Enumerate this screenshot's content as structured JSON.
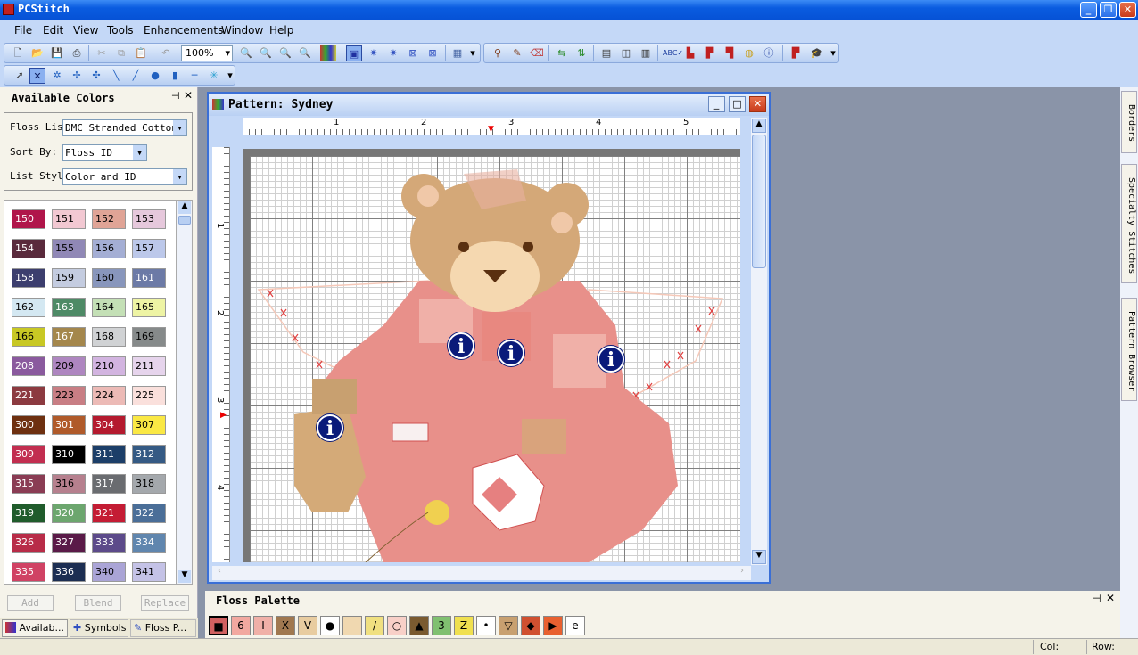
{
  "app": {
    "title": "PCStitch"
  },
  "menu": [
    "File",
    "Edit",
    "View",
    "Tools",
    "Enhancements",
    "Window",
    "Help"
  ],
  "toolbar": {
    "zoom": "100%"
  },
  "available_colors": {
    "title": "Available Colors",
    "floss_list_label": "Floss List:",
    "floss_list_value": "DMC Stranded Cotton",
    "sort_by_label": "Sort By:",
    "sort_by_value": "Floss ID",
    "list_style_label": "List Style:",
    "list_style_value": "Color and ID",
    "swatches": [
      {
        "id": "150",
        "color": "#b0154a",
        "text": "#fff"
      },
      {
        "id": "151",
        "color": "#f2c8d2",
        "text": "#000"
      },
      {
        "id": "152",
        "color": "#e0a496",
        "text": "#000"
      },
      {
        "id": "153",
        "color": "#e6c8dc",
        "text": "#000"
      },
      {
        "id": "154",
        "color": "#5a2a3c",
        "text": "#fff"
      },
      {
        "id": "155",
        "color": "#9088b6",
        "text": "#000"
      },
      {
        "id": "156",
        "color": "#a4aed4",
        "text": "#000"
      },
      {
        "id": "157",
        "color": "#bcc8ea",
        "text": "#000"
      },
      {
        "id": "158",
        "color": "#3c3e6e",
        "text": "#fff"
      },
      {
        "id": "159",
        "color": "#c4cce0",
        "text": "#000"
      },
      {
        "id": "160",
        "color": "#8896bc",
        "text": "#000"
      },
      {
        "id": "161",
        "color": "#6c7aa6",
        "text": "#fff"
      },
      {
        "id": "162",
        "color": "#d4e8f2",
        "text": "#000"
      },
      {
        "id": "163",
        "color": "#4e8a66",
        "text": "#fff"
      },
      {
        "id": "164",
        "color": "#c4e0b6",
        "text": "#000"
      },
      {
        "id": "165",
        "color": "#eef4a4",
        "text": "#000"
      },
      {
        "id": "166",
        "color": "#c8c824",
        "text": "#000"
      },
      {
        "id": "167",
        "color": "#a4874c",
        "text": "#fff"
      },
      {
        "id": "168",
        "color": "#d0d2d4",
        "text": "#000"
      },
      {
        "id": "169",
        "color": "#868a8a",
        "text": "#000"
      },
      {
        "id": "208",
        "color": "#8a5a9e",
        "text": "#fff"
      },
      {
        "id": "209",
        "color": "#ae86c0",
        "text": "#000"
      },
      {
        "id": "210",
        "color": "#d2b4e0",
        "text": "#000"
      },
      {
        "id": "211",
        "color": "#e6d4ec",
        "text": "#000"
      },
      {
        "id": "221",
        "color": "#8c3a40",
        "text": "#fff"
      },
      {
        "id": "223",
        "color": "#c87e84",
        "text": "#000"
      },
      {
        "id": "224",
        "color": "#ecbab6",
        "text": "#000"
      },
      {
        "id": "225",
        "color": "#fae0dc",
        "text": "#000"
      },
      {
        "id": "300",
        "color": "#6e3010",
        "text": "#fff"
      },
      {
        "id": "301",
        "color": "#b05a2a",
        "text": "#fff"
      },
      {
        "id": "304",
        "color": "#b41a2e",
        "text": "#fff"
      },
      {
        "id": "307",
        "color": "#fae844",
        "text": "#000"
      },
      {
        "id": "309",
        "color": "#c22e50",
        "text": "#fff"
      },
      {
        "id": "310",
        "color": "#000000",
        "text": "#fff"
      },
      {
        "id": "311",
        "color": "#1c3e68",
        "text": "#fff"
      },
      {
        "id": "312",
        "color": "#355a84",
        "text": "#fff"
      },
      {
        "id": "315",
        "color": "#8a3c54",
        "text": "#fff"
      },
      {
        "id": "316",
        "color": "#b6808e",
        "text": "#000"
      },
      {
        "id": "317",
        "color": "#6a6c70",
        "text": "#fff"
      },
      {
        "id": "318",
        "color": "#a4a8ac",
        "text": "#000"
      },
      {
        "id": "319",
        "color": "#205c2c",
        "text": "#fff"
      },
      {
        "id": "320",
        "color": "#6ca66e",
        "text": "#fff"
      },
      {
        "id": "321",
        "color": "#c41c34",
        "text": "#fff"
      },
      {
        "id": "322",
        "color": "#4a6e98",
        "text": "#fff"
      },
      {
        "id": "326",
        "color": "#b82c48",
        "text": "#fff"
      },
      {
        "id": "327",
        "color": "#5a1a48",
        "text": "#fff"
      },
      {
        "id": "333",
        "color": "#5c4a8a",
        "text": "#fff"
      },
      {
        "id": "334",
        "color": "#6086ae",
        "text": "#fff"
      },
      {
        "id": "335",
        "color": "#d04264",
        "text": "#fff"
      },
      {
        "id": "336",
        "color": "#1c2e52",
        "text": "#fff"
      },
      {
        "id": "340",
        "color": "#aaa4d6",
        "text": "#000"
      },
      {
        "id": "341",
        "color": "#c4c2e6",
        "text": "#000"
      }
    ],
    "add_label": "Add",
    "blend_label": "Blend",
    "replace_label": "Replace"
  },
  "bottom_tabs": [
    {
      "label": "Availab..."
    },
    {
      "label": "Symbols"
    },
    {
      "label": "Floss P..."
    }
  ],
  "pattern": {
    "title": "Pattern: Sydney",
    "ruler_h": [
      "1",
      "2",
      "3",
      "4",
      "5"
    ],
    "ruler_v": [
      "1",
      "2",
      "3",
      "4"
    ]
  },
  "side_tabs": [
    "Borders",
    "Specialty Stitches",
    "Pattern Browser"
  ],
  "floss_palette": {
    "title": "Floss Palette",
    "swatches": [
      {
        "sym": "■",
        "color": "#d06060"
      },
      {
        "sym": "6",
        "color": "#f2a8a0"
      },
      {
        "sym": "I",
        "color": "#f0b0a8"
      },
      {
        "sym": "X",
        "color": "#a07850"
      },
      {
        "sym": "V",
        "color": "#e8cca0"
      },
      {
        "sym": "●",
        "color": "#ffffff"
      },
      {
        "sym": "—",
        "color": "#f0d8b0"
      },
      {
        "sym": "/",
        "color": "#f0e080"
      },
      {
        "sym": "○",
        "color": "#f8d0c8"
      },
      {
        "sym": "▲",
        "color": "#7a5a30"
      },
      {
        "sym": "3",
        "color": "#80c070"
      },
      {
        "sym": "Z",
        "color": "#f0e050"
      },
      {
        "sym": "•",
        "color": "#ffffff"
      },
      {
        "sym": "▽",
        "color": "#c8a070"
      },
      {
        "sym": "◆",
        "color": "#d05030"
      },
      {
        "sym": "▶",
        "color": "#e86030"
      },
      {
        "sym": "e",
        "color": "#ffffff"
      }
    ]
  },
  "status": {
    "col_label": "Col:",
    "row_label": "Row:"
  }
}
